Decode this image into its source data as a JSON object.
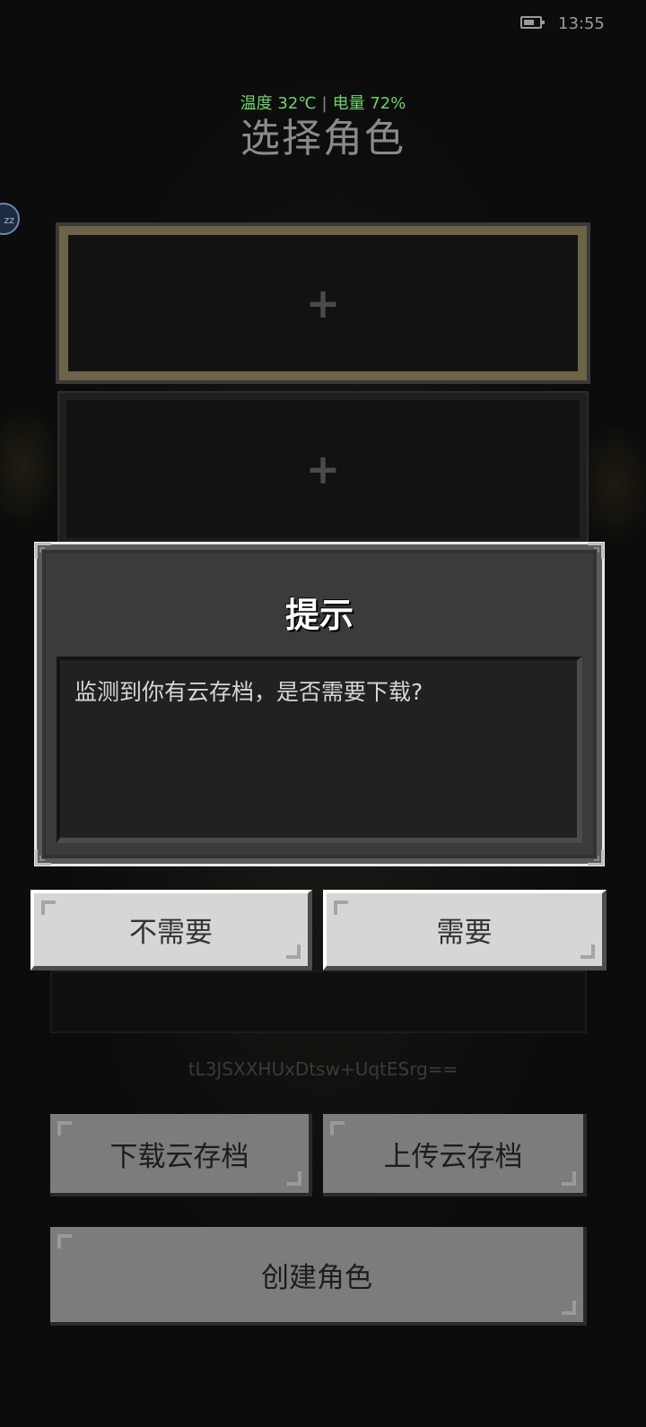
{
  "status_bar": {
    "time": "13:55",
    "battery_icon": "battery-icon"
  },
  "overlay": {
    "temperature": "温度 32℃",
    "battery": "电量 72%"
  },
  "page": {
    "title": "选择角色",
    "side_bubble": "zz"
  },
  "slots": [
    {
      "label": "+",
      "selected": true
    },
    {
      "label": "+",
      "selected": false
    }
  ],
  "save_code": "tL3JSXXHUxDtsw+UqtESrg==",
  "buttons": {
    "download_cloud": "下载云存档",
    "upload_cloud": "上传云存档",
    "create_character": "创建角色"
  },
  "dialog": {
    "title": "提示",
    "message": "监测到你有云存档，是否需要下载?",
    "no_label": "不需要",
    "yes_label": "需要"
  },
  "colors": {
    "selected_slot_border": "#6b6446",
    "overlay_text": "#6cd46a",
    "dialog_bg": "#3b3b3b",
    "button_bright": "#d6d6d6"
  }
}
